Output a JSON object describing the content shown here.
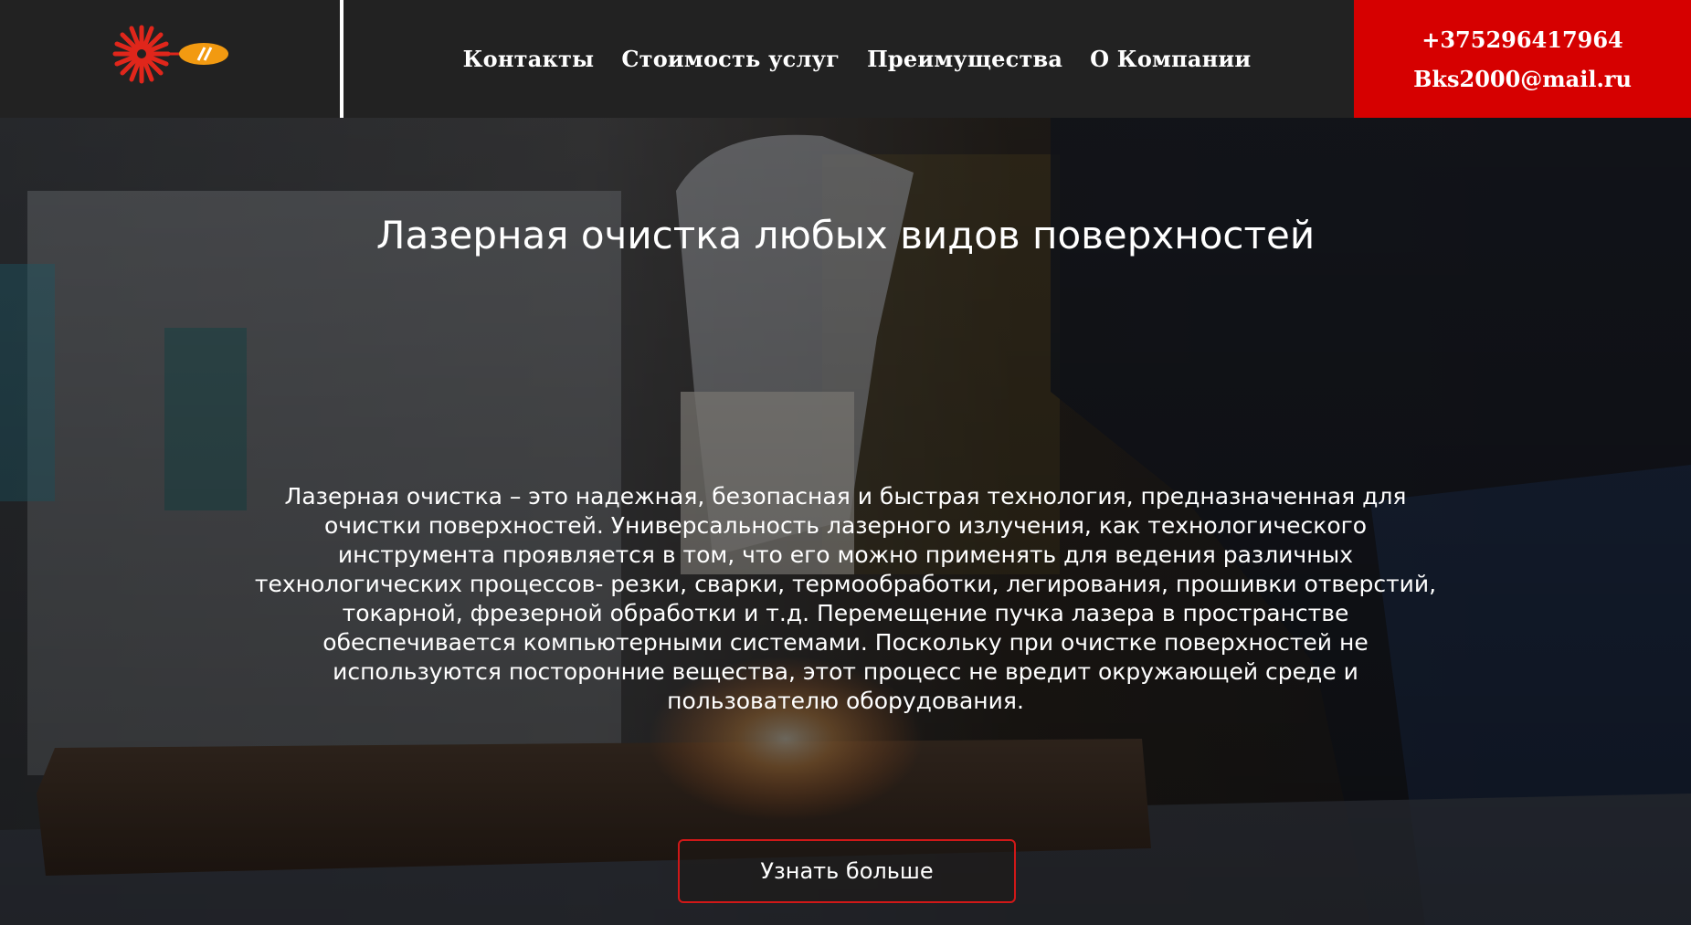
{
  "header": {
    "nav": [
      {
        "label": "Контакты"
      },
      {
        "label": "Стоимость услуг"
      },
      {
        "label": "Преимущества"
      },
      {
        "label": "О Компании"
      }
    ],
    "contacts": {
      "phone": "+375296417964",
      "email": "Bks2000@mail.ru"
    }
  },
  "hero": {
    "title": "Лазерная очистка любых видов поверхностей",
    "text": "Лазерная очистка – это надежная, безопасная и быстрая технология, предназначенная для очистки поверхностей. Универсальность лазерного излучения, как технологического инструмента проявляется в том, что его можно применять для ведения различных технологических процессов- резки, сварки, термообработки, легирования, прошивки отверстий, токарной, фрезерной обработки и т.д. Перемещение пучка лазера в пространстве обеспечивается компьютерными системами. Поскольку при очистке поверхностей не используются посторонние вещества, этот процесс не вредит окружающей среде и пользователю оборудования.",
    "cta_label": "Узнать больше"
  },
  "colors": {
    "header_bg": "#222222",
    "accent_red": "#d60000",
    "text": "#ffffff"
  },
  "icons": {
    "logo": "laser-logo-icon"
  }
}
